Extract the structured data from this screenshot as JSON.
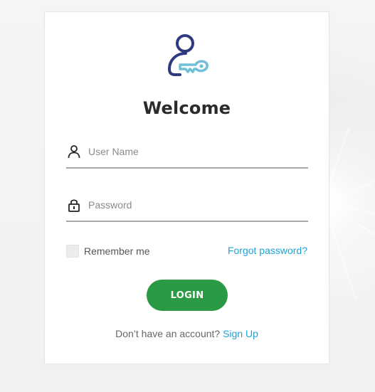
{
  "login": {
    "title": "Welcome",
    "username": {
      "placeholder": "User Name",
      "value": "",
      "icon": "user-icon"
    },
    "password": {
      "placeholder": "Password",
      "value": "",
      "icon": "lock-icon"
    },
    "remember_label": "Remember me",
    "remember_checked": false,
    "forgot_label": "Forgot password?",
    "login_label": "LOGIN",
    "signup_prompt": "Don’t have an account?",
    "signup_label": "Sign Up"
  },
  "logo": {
    "icon": "user-key-icon",
    "colors": {
      "person": "#2f3a7e",
      "key": "#6fbfd8"
    }
  },
  "colors": {
    "primary_button": "#2b9a44",
    "link": "#1ea3d8",
    "title_text": "#2b2b2b"
  }
}
